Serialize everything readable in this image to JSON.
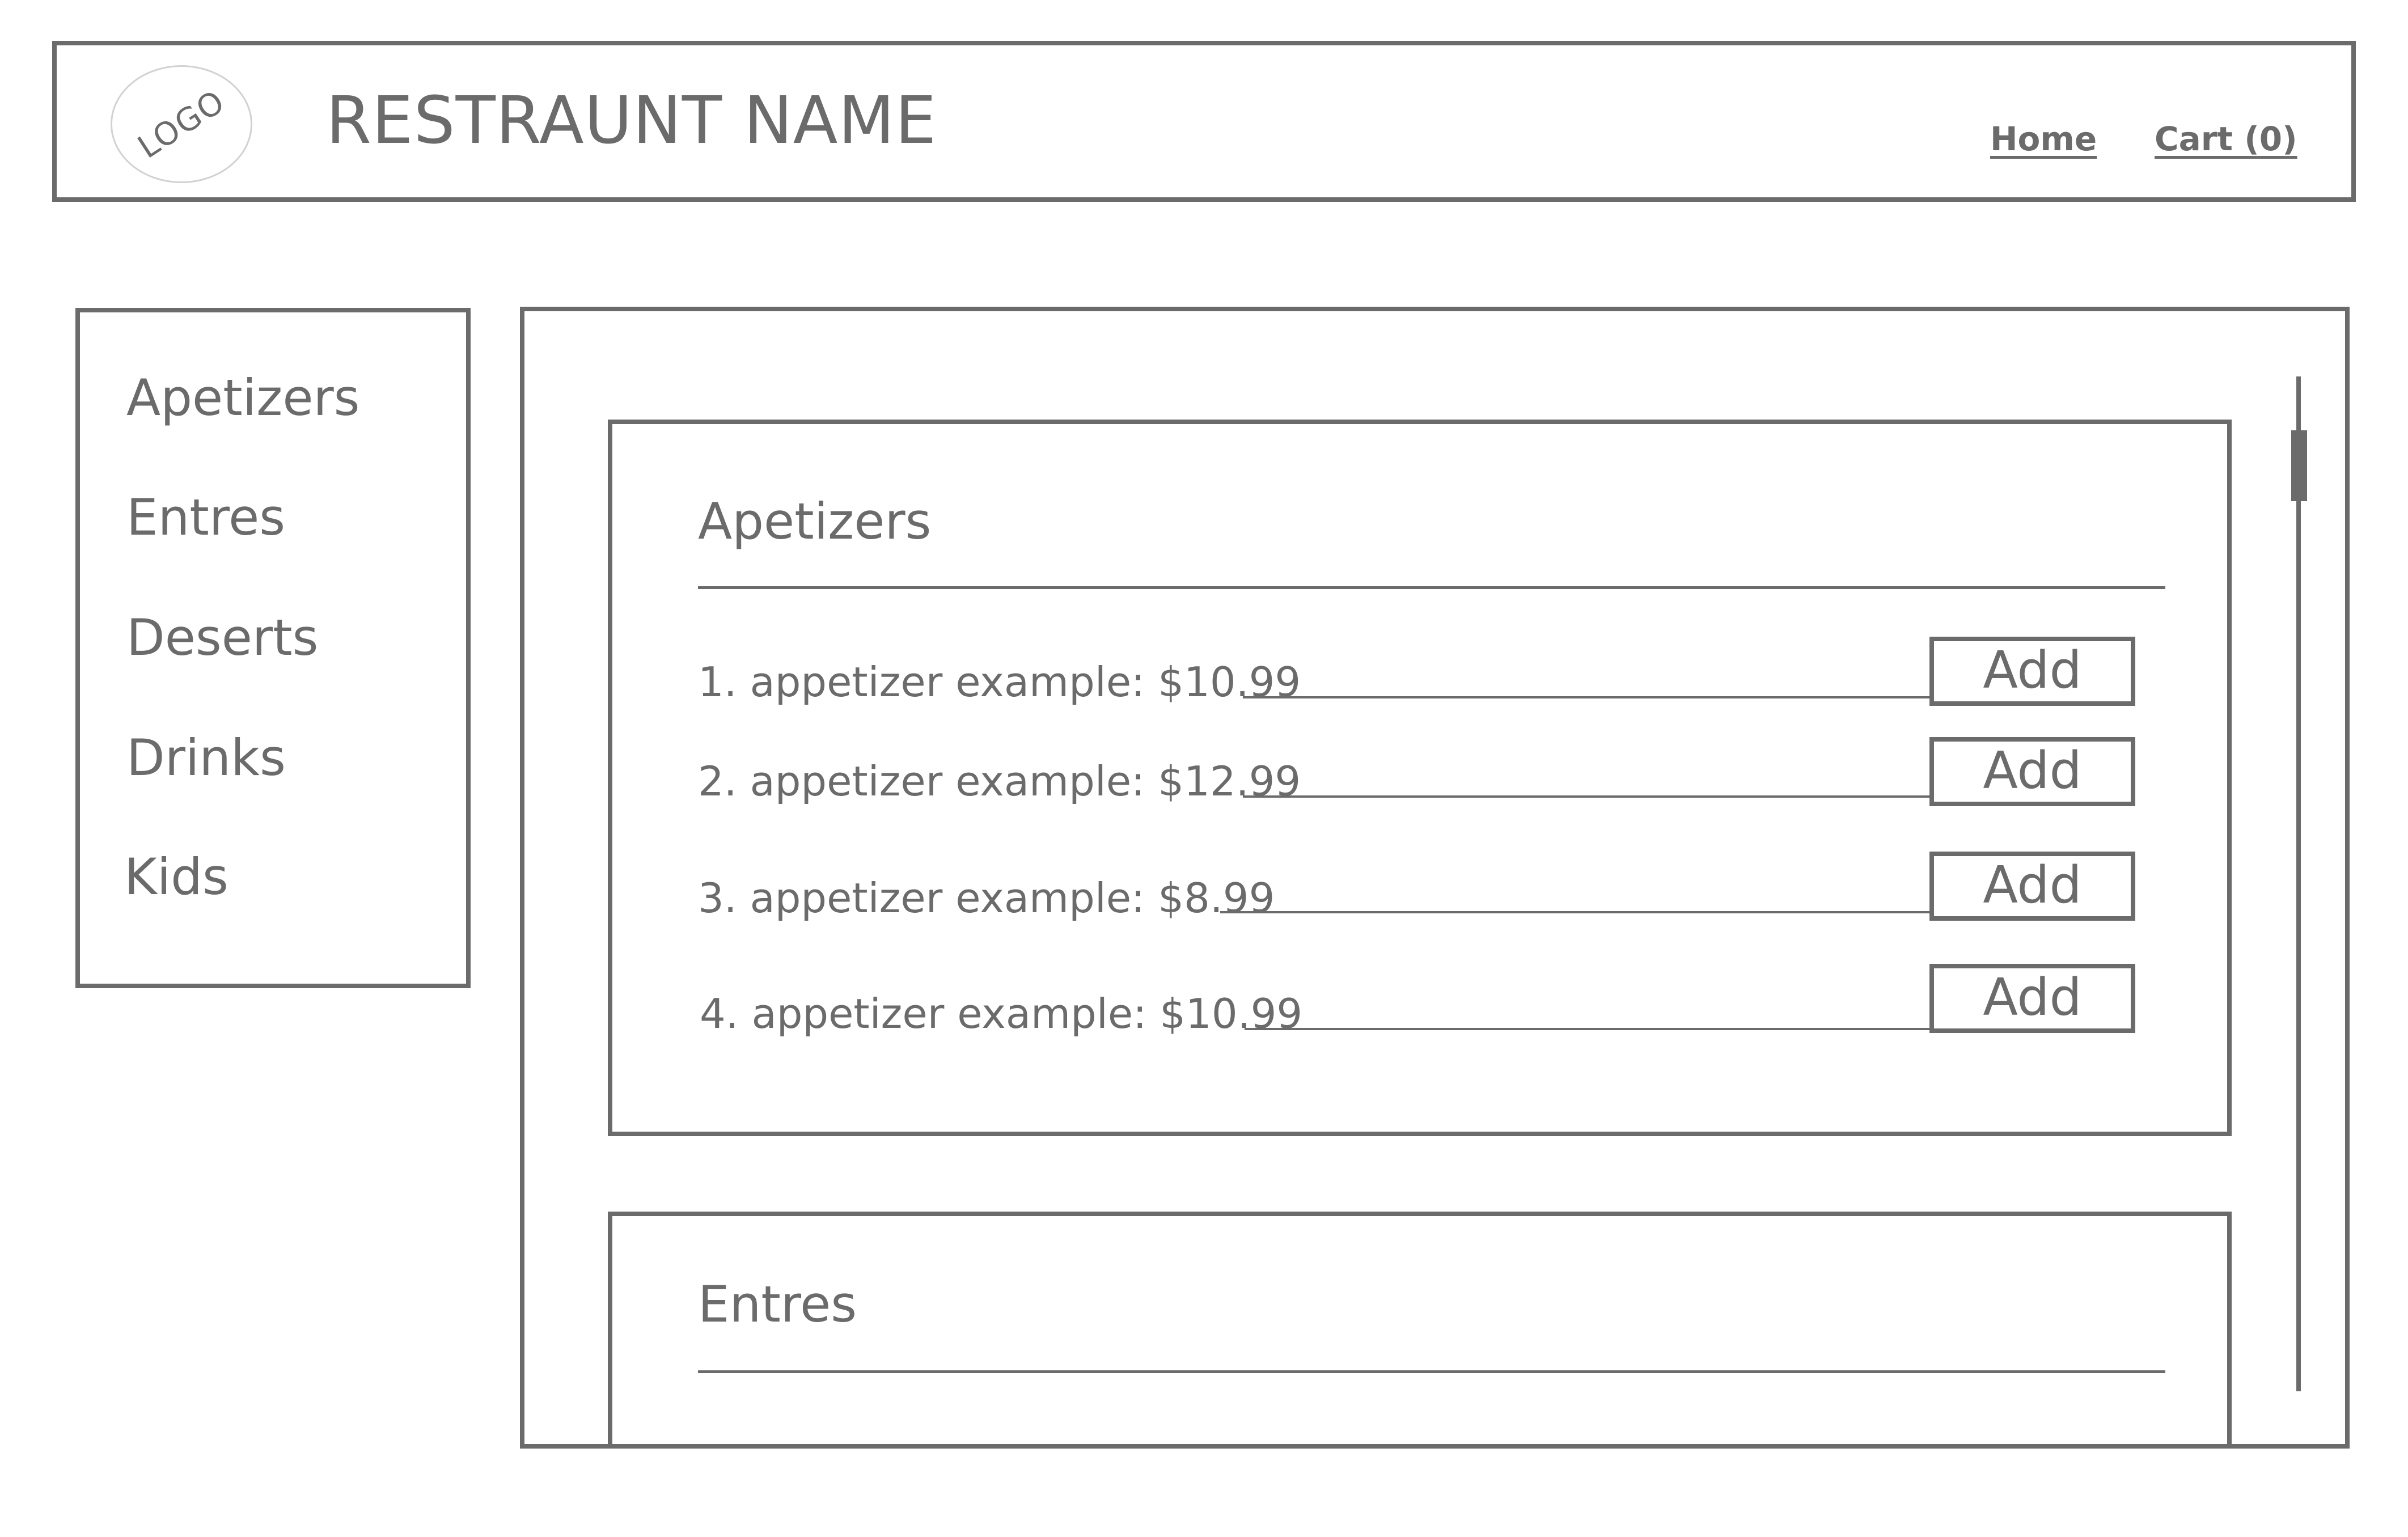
{
  "header": {
    "logo_text": "LOGO",
    "title": "RESTRAUNT NAME",
    "nav": {
      "home": "Home",
      "cart": "Cart (0)"
    }
  },
  "sidebar": {
    "items": [
      {
        "label": "Apetizers"
      },
      {
        "label": "Entres"
      },
      {
        "label": "Deserts"
      },
      {
        "label": "Drinks"
      },
      {
        "label": "Kids"
      }
    ]
  },
  "main": {
    "sections": [
      {
        "title": "Apetizers",
        "items": [
          {
            "text": "1. appetizer example:  $10.99",
            "button": "Add"
          },
          {
            "text": "2. appetizer example:  $12.99",
            "button": "Add"
          },
          {
            "text": "3. appetizer example:  $8.99",
            "button": "Add"
          },
          {
            "text": "4. appetizer example:  $10.99",
            "button": "Add"
          }
        ]
      },
      {
        "title": "Entres",
        "items": []
      }
    ]
  },
  "colors": {
    "wireframe": "#6b6b6b",
    "logo_outline": "#d2d2d2",
    "background": "#ffffff"
  }
}
